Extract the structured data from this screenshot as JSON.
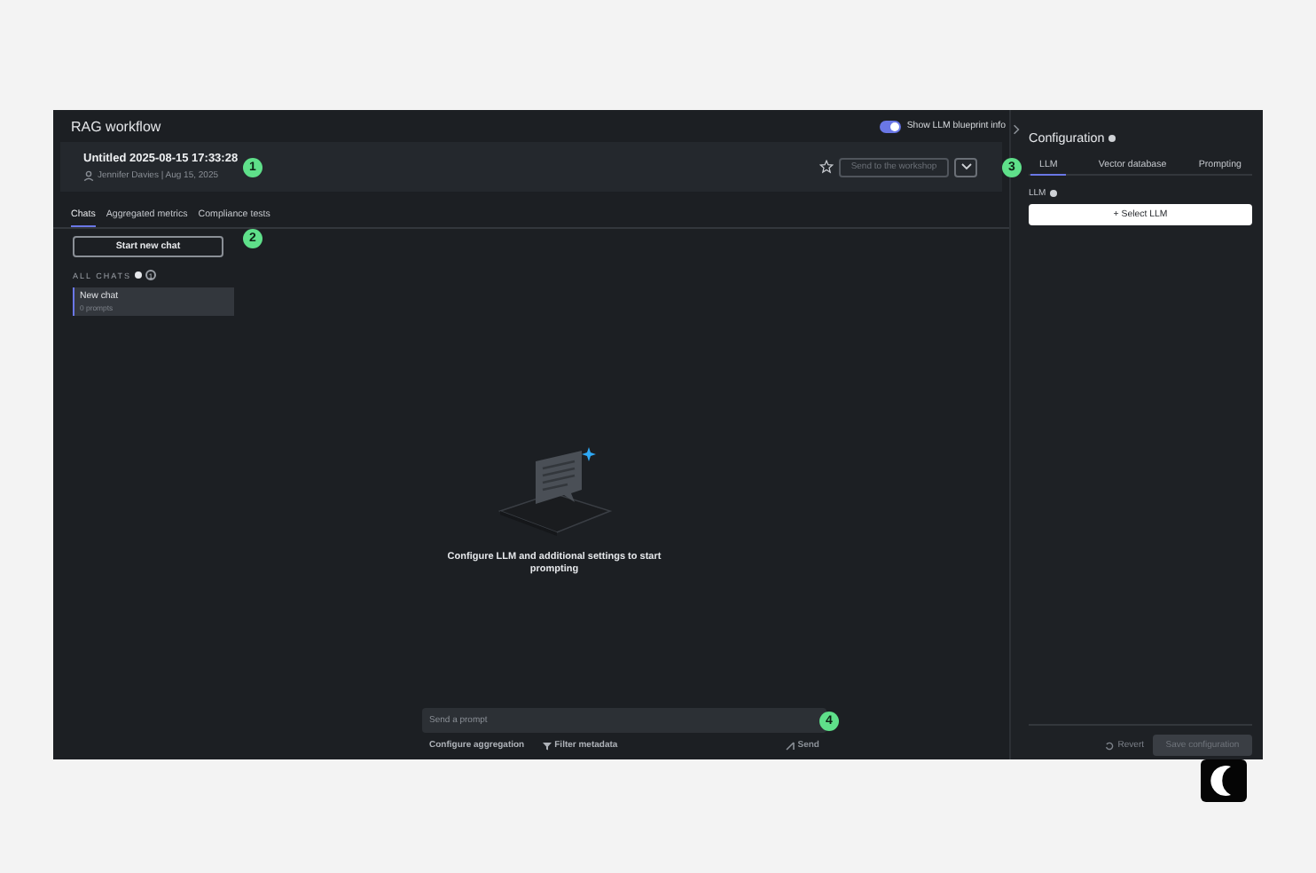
{
  "app_title": "RAG workflow",
  "blueprint_toggle": {
    "label": "Show LLM blueprint info",
    "on": true
  },
  "header": {
    "title": "Untitled 2025-08-15 17:33:28",
    "meta": "Jennifer Davies | Aug 15, 2025",
    "send_button": "Send to the workshop"
  },
  "tabs": [
    {
      "label": "Chats",
      "selected": true
    },
    {
      "label": "Aggregated metrics",
      "selected": false
    },
    {
      "label": "Compliance tests",
      "selected": false
    }
  ],
  "start_button": "Start new chat",
  "chats_heading": "ALL CHATS",
  "chats_count": "1",
  "chats": [
    {
      "title": "New chat",
      "subtitle": "0 prompts",
      "selected": true
    }
  ],
  "empty_state": "Configure LLM and additional settings to start prompting",
  "prompt": {
    "placeholder": "Send a prompt",
    "actions": [
      "Configure aggregation",
      "Filter metadata"
    ],
    "send": "Send"
  },
  "configuration": {
    "title": "Configuration",
    "tabs": [
      {
        "label": "LLM",
        "selected": true
      },
      {
        "label": "Vector database",
        "selected": false
      },
      {
        "label": "Prompting",
        "selected": false
      }
    ],
    "llm_label": "LLM",
    "select_button": "+ Select LLM",
    "revert": "Revert",
    "save": "Save configuration"
  },
  "markers": [
    "1",
    "2",
    "3",
    "4"
  ]
}
